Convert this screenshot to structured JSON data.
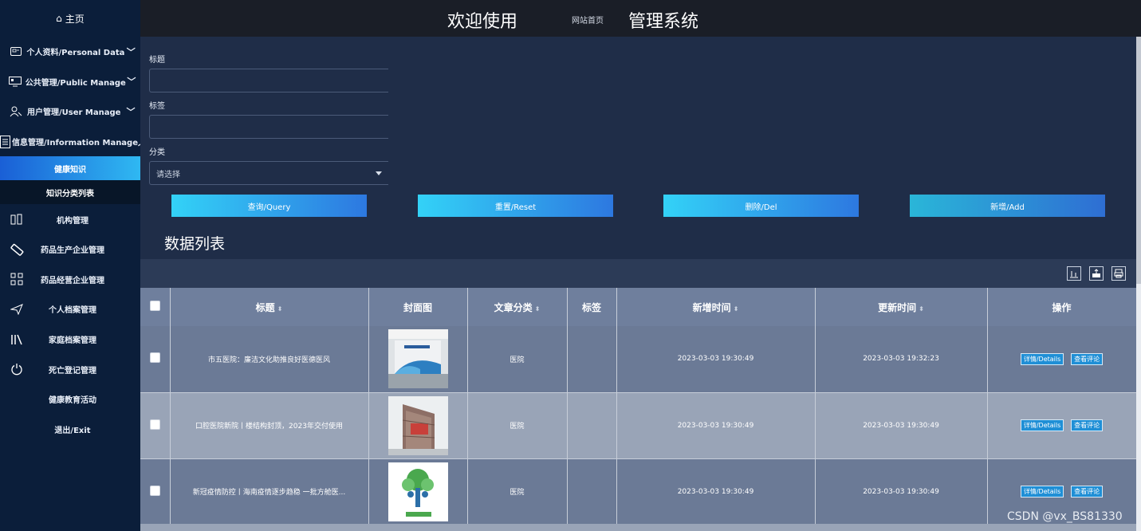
{
  "header": {
    "welcome": "欢迎使用",
    "home_link": "网站首页",
    "system": "管理系统"
  },
  "sidebar": {
    "home": "主页",
    "groups": [
      {
        "label": "个人资料/Personal Data",
        "icon": "id-card-icon"
      },
      {
        "label": "公共管理/Public Manage",
        "icon": "monitor-icon"
      },
      {
        "label": "用户管理/User Manage",
        "icon": "user-key-icon"
      },
      {
        "label": "信息管理/Information Manage",
        "icon": "document-icon"
      }
    ],
    "subitems": [
      "健康知识",
      "知识分类列表"
    ],
    "items": [
      {
        "label": "机构管理",
        "icon": "building-icon"
      },
      {
        "label": "药品生产企业管理",
        "icon": "pill-icon"
      },
      {
        "label": "药品经营企业管理",
        "icon": "grid-icon"
      },
      {
        "label": "个人档案管理",
        "icon": "send-icon"
      },
      {
        "label": "家庭档案管理",
        "icon": "books-icon"
      },
      {
        "label": "死亡登记管理",
        "icon": "power-icon"
      },
      {
        "label": "健康教育活动",
        "icon": ""
      },
      {
        "label": "退出/Exit",
        "icon": ""
      }
    ]
  },
  "form": {
    "title_label": "标题",
    "tag_label": "标签",
    "category_label": "分类",
    "category_placeholder": "请选择",
    "query": "查询/Query",
    "reset": "重置/Reset",
    "delete": "删除/Del",
    "add": "新增/Add",
    "list_title": "数据列表"
  },
  "table": {
    "headers": [
      "标题",
      "封面图",
      "文章分类",
      "标签",
      "新增时间",
      "更新时间",
      "操作"
    ],
    "details_btn": "详情/Details",
    "comments_btn": "查看评论",
    "rows": [
      {
        "title": "市五医院：廉洁文化助推良好医德医风",
        "category": "医院",
        "tag": "",
        "created": "2023-03-03 19:30:49",
        "updated": "2023-03-03 19:32:23"
      },
      {
        "title": "口腔医院新院丨楼结构封顶，2023年交付使用",
        "category": "医院",
        "tag": "",
        "created": "2023-03-03 19:30:49",
        "updated": "2023-03-03 19:30:49"
      },
      {
        "title": "新冠疫情防控丨海南疫情逐步趋稳 一批方舱医...",
        "category": "医院",
        "tag": "",
        "created": "2023-03-03 19:30:49",
        "updated": "2023-03-03 19:30:49"
      }
    ]
  },
  "watermark": "CSDN @vx_BS81330"
}
